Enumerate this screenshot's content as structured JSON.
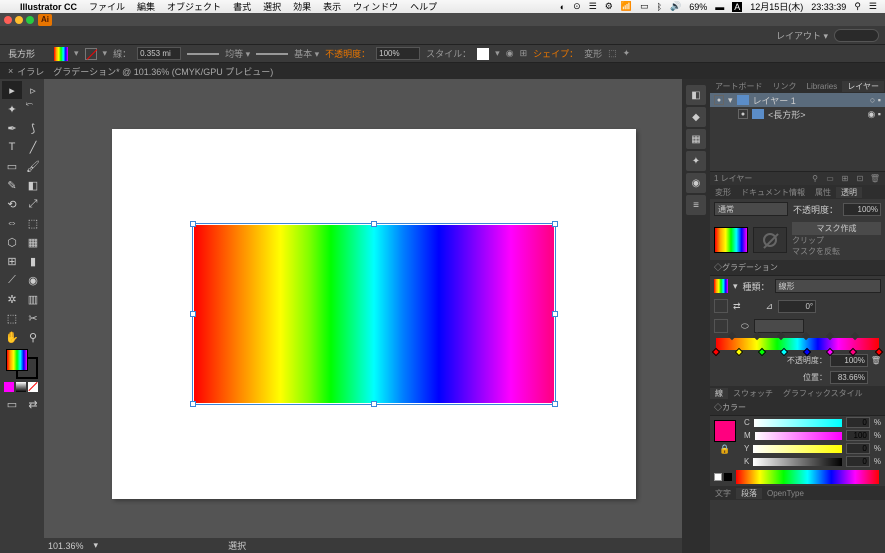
{
  "menubar": {
    "app": "Illustrator CC",
    "items": [
      "ファイル",
      "編集",
      "オブジェクト",
      "書式",
      "選択",
      "効果",
      "表示",
      "ウィンドウ",
      "ヘルプ"
    ],
    "battery": "69%",
    "date": "12月15日(木)",
    "time": "23:33:39"
  },
  "layoutrow": {
    "label": "レイアウト ▾"
  },
  "controlbar": {
    "shape": "長方形",
    "stroke_label": "線：",
    "stroke_width": "0.353 mi",
    "uniform": "均等 ▾",
    "basic": "基本 ▾",
    "opacity_label": "不透明度：",
    "opacity": "100%",
    "style_label": "スタイル：",
    "shape_link": "シェイプ：",
    "transform": "変形"
  },
  "doctab": {
    "title": "イラレ　グラデーション* @ 101.36% (CMYK/GPU プレビュー)"
  },
  "statusbar": {
    "zoom": "101.36%",
    "tool": "選択"
  },
  "panels": {
    "layers": {
      "tabs": [
        "アートボード",
        "リンク",
        "Libraries",
        "レイヤー"
      ],
      "layer1": "レイヤー 1",
      "item": "<長方形>",
      "footer": "1 レイヤー"
    },
    "transform_tabs": [
      "変形",
      "ドキュメント情報",
      "属性",
      "透明"
    ],
    "transparency": {
      "mode": "通常",
      "opacity_label": "不透明度：",
      "opacity": "100%",
      "make_mask": "マスク作成",
      "clip": "クリップ",
      "invert": "マスクを反転"
    },
    "gradient": {
      "title": "◇グラデーション",
      "type_label": "種類：",
      "type": "線形",
      "angle": "0°",
      "opacity_label": "不透明度：",
      "opacity": "100%",
      "location_label": "位置：",
      "location": "83.66%"
    },
    "stroke_tabs": [
      "線",
      "スウォッチ",
      "グラフィックスタイル"
    ],
    "color": {
      "title": "◇カラー",
      "c": "0",
      "m": "100",
      "y": "0",
      "k": "0"
    },
    "char_tabs": [
      "文字",
      "段落",
      "OpenType"
    ]
  }
}
